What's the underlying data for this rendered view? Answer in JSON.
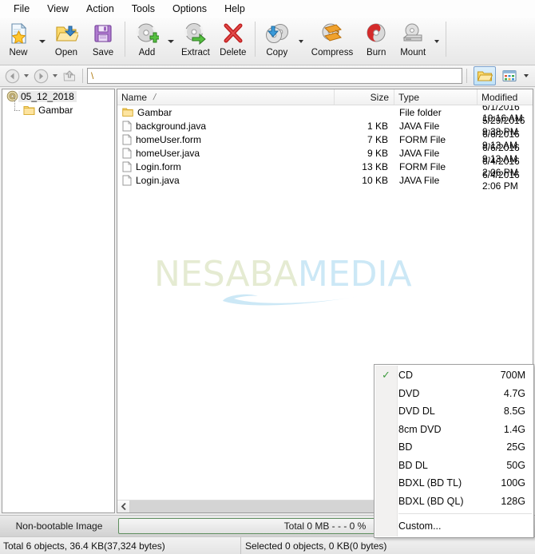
{
  "menubar": {
    "items": [
      "File",
      "View",
      "Action",
      "Tools",
      "Options",
      "Help"
    ]
  },
  "toolbar": {
    "buttons": [
      {
        "label": "New",
        "icon": "new-page-star-icon",
        "dropdown": true
      },
      {
        "label": "Open",
        "icon": "open-folder-icon",
        "dropdown": false
      },
      {
        "label": "Save",
        "icon": "save-floppy-icon",
        "dropdown": false
      },
      {
        "label": "Add",
        "icon": "add-disc-icon",
        "dropdown": true
      },
      {
        "label": "Extract",
        "icon": "extract-disc-icon",
        "dropdown": false
      },
      {
        "label": "Delete",
        "icon": "delete-x-icon",
        "dropdown": false
      },
      {
        "label": "Copy",
        "icon": "copy-disc-icon",
        "dropdown": true
      },
      {
        "label": "Compress",
        "icon": "compress-disc-icon",
        "dropdown": false
      },
      {
        "label": "Burn",
        "icon": "burn-disc-icon",
        "dropdown": false
      },
      {
        "label": "Mount",
        "icon": "mount-drive-icon",
        "dropdown": true
      }
    ]
  },
  "navbar": {
    "back_icon": "back-arrow-icon",
    "forward_icon": "forward-arrow-icon",
    "up_icon": "up-folder-icon",
    "address_value": "\\",
    "address_placeholder": "",
    "view_folder_icon": "folder-view-icon",
    "view_detail_icon": "detail-view-icon"
  },
  "tree": {
    "root": {
      "label": "05_12_2018",
      "icon": "disc-icon",
      "selected": true
    },
    "children": [
      {
        "label": "Gambar",
        "icon": "folder-icon"
      }
    ]
  },
  "filelist": {
    "columns": [
      "Name",
      "Size",
      "Type",
      "Modified"
    ],
    "sort_indicator": "/",
    "rows": [
      {
        "name": "Gambar",
        "size": "",
        "type": "File folder",
        "modified": "6/1/2016 10:16 AM",
        "icon": "folder-icon"
      },
      {
        "name": "background.java",
        "size": "1 KB",
        "type": "JAVA File",
        "modified": "5/29/2016 9:38 PM",
        "icon": "file-icon"
      },
      {
        "name": "homeUser.form",
        "size": "7 KB",
        "type": "FORM File",
        "modified": "6/6/2016 9:13 AM",
        "icon": "file-icon"
      },
      {
        "name": "homeUser.java",
        "size": "9 KB",
        "type": "JAVA File",
        "modified": "6/6/2016 9:13 AM",
        "icon": "file-icon"
      },
      {
        "name": "Login.form",
        "size": "13 KB",
        "type": "FORM File",
        "modified": "6/4/2016 2:06 PM",
        "icon": "file-icon"
      },
      {
        "name": "Login.java",
        "size": "10 KB",
        "type": "JAVA File",
        "modified": "6/4/2016 2:06 PM",
        "icon": "file-icon"
      }
    ]
  },
  "watermark": {
    "part1": "NESABA",
    "part2": "MEDIA"
  },
  "contextmenu": {
    "items": [
      {
        "label": "CD",
        "size": "700M",
        "checked": true
      },
      {
        "label": "DVD",
        "size": "4.7G",
        "checked": false
      },
      {
        "label": "DVD DL",
        "size": "8.5G",
        "checked": false
      },
      {
        "label": "8cm DVD",
        "size": "1.4G",
        "checked": false
      },
      {
        "label": "BD",
        "size": "25G",
        "checked": false
      },
      {
        "label": "BD DL",
        "size": "50G",
        "checked": false
      },
      {
        "label": "BDXL (BD TL)",
        "size": "100G",
        "checked": false
      },
      {
        "label": "BDXL (BD QL)",
        "size": "128G",
        "checked": false
      }
    ],
    "custom_label": "Custom...",
    "check_glyph": "✓"
  },
  "statusbar": {
    "boot_label": "Non-bootable Image",
    "progress_text": "Total  0 MB  - - -  0 %",
    "progress_percent": 0,
    "total_text": "Total 6 objects, 36.4 KB(37,324 bytes)",
    "selected_text": "Selected 0 objects, 0 KB(0 bytes)"
  },
  "colors": {
    "accent_blue": "#bfe2f7",
    "check_green": "#3f9b3f",
    "folder_yellow": "#fcd976",
    "watermark_green": "#e5ebd2",
    "watermark_blue": "#cce8f6"
  }
}
